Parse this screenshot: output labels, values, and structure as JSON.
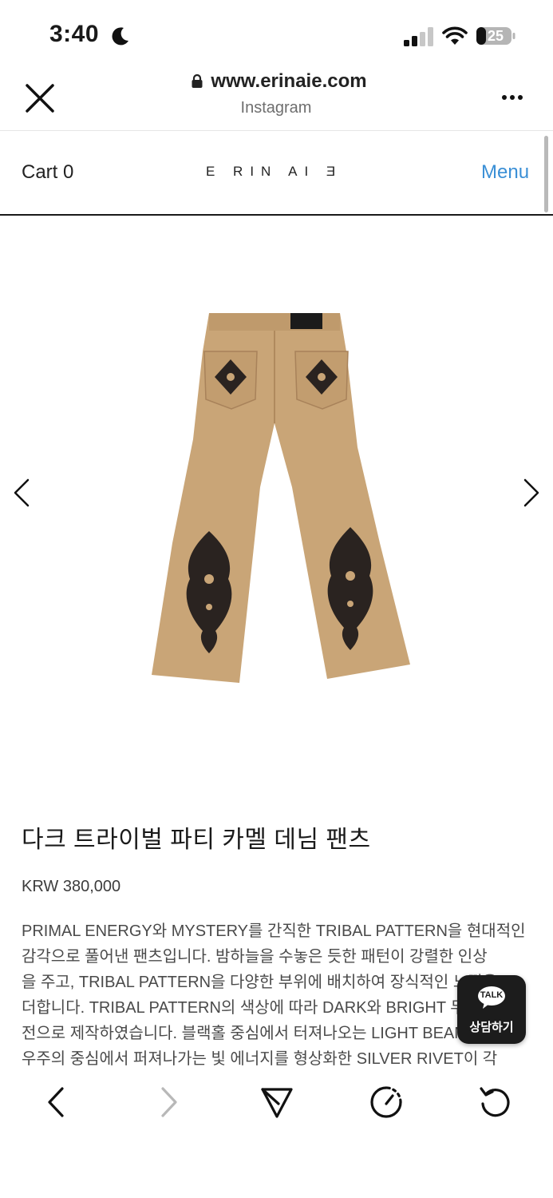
{
  "status_bar": {
    "time": "3:40",
    "battery_level": "25",
    "icons": [
      "moon-icon",
      "signal-icon",
      "wifi-icon",
      "battery-icon"
    ]
  },
  "browser": {
    "url": "www.erinaie.com",
    "source": "Instagram",
    "icons": [
      "close-icon",
      "lock-icon",
      "more-icon"
    ]
  },
  "site_nav": {
    "cart_label": "Cart",
    "cart_count": "0",
    "logo": "E RIN AI Ǝ",
    "menu_label": "Menu"
  },
  "product": {
    "title": "다크 트라이벌 파티 카멜 데님 팬츠",
    "price": "KRW 380,000",
    "description_lines": [
      "PRIMAL ENERGY와 MYSTERY를 간직한 TRIBAL PATTERN을 현대적인",
      "감각으로 풀어낸 팬츠입니다. 밤하늘을 수놓은 듯한 패턴이 강렬한 인상",
      "을 주고, TRIBAL PATTERN을 다양한 부위에 배치하여 장식적인 느낌을",
      "더합니다. TRIBAL PATTERN의 색상에 따라 DARK와 BRIGHT 두 가지 버",
      "전으로 제작하였습니다. 블랙홀 중심에서 터져나오는 LIGHT BEAM과,",
      "우주의 중심에서 퍼져나가는 빛 에너지를 형상화한 SILVER RIVET이 각"
    ],
    "image_colors": {
      "fabric": "#c8a477",
      "pattern": "#2a2320"
    }
  },
  "chat_widget": {
    "badge": "TALK",
    "label": "상담하기"
  },
  "toolbar": {
    "icons": [
      "back-icon",
      "forward-icon",
      "share-icon",
      "speed-icon",
      "reload-icon"
    ]
  },
  "colors": {
    "menu_link": "#3a8fd6",
    "chat_bg": "#1c1c1c"
  }
}
